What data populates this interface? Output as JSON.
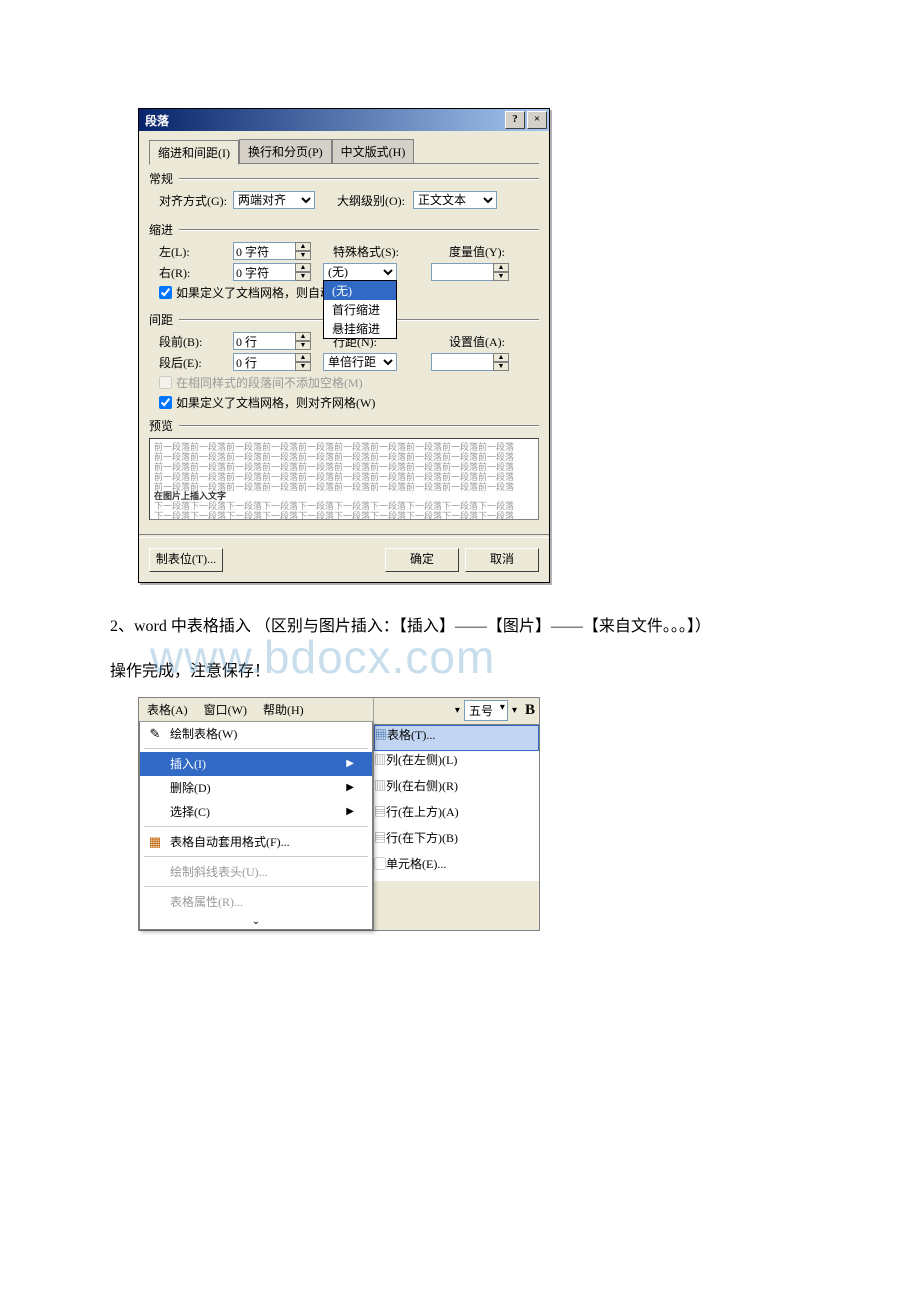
{
  "dialog": {
    "title": "段落",
    "tabs": [
      "缩进和间距(I)",
      "换行和分页(P)",
      "中文版式(H)"
    ],
    "groups": {
      "general": "常规",
      "alignment_label": "对齐方式(G):",
      "alignment_value": "两端对齐",
      "outline_label": "大纲级别(O):",
      "outline_value": "正文文本",
      "indent": "缩进",
      "left_label": "左(L):",
      "left_value": "0 字符",
      "right_label": "右(R):",
      "right_value": "0 字符",
      "special_label": "特殊格式(S):",
      "special_value": "(无)",
      "measure_label": "度量值(Y):",
      "special_options": [
        "(无)",
        "首行缩进",
        "悬挂缩进"
      ],
      "chk_grid_indent": "如果定义了文档网格，则自动调",
      "spacing": "间距",
      "before_label": "段前(B):",
      "before_value": "0 行",
      "after_label": "段后(E):",
      "after_value": "0 行",
      "linespacing_label": "行距(N):",
      "linespacing_value": "单倍行距",
      "setvalue_label": "设置值(A):",
      "chk_nospace": "在相同样式的段落间不添加空格(M)",
      "chk_grid_align": "如果定义了文档网格，则对齐网格(W)",
      "preview": "预览",
      "preview_lines": [
        "前一段落前一段落前一段落前一段落前一段落前一段落前一段落前一段落前一段落前一段落",
        "前一段落前一段落前一段落前一段落前一段落前一段落前一段落前一段落前一段落前一段落",
        "前一段落前一段落前一段落前一段落前一段落前一段落前一段落前一段落前一段落前一段落",
        "前一段落前一段落前一段落前一段落前一段落前一段落前一段落前一段落前一段落前一段落",
        "前一段落前一段落前一段落前一段落前一段落前一段落前一段落前一段落前一段落前一段落",
        "在图片上插入文字",
        "下一段落下一段落下一段落下一段落下一段落下一段落下一段落下一段落下一段落下一段落",
        "下一段落下一段落下一段落下一段落下一段落下一段落下一段落下一段落下一段落下一段落"
      ]
    },
    "buttons": {
      "tabstops": "制表位(T)...",
      "ok": "确定",
      "cancel": "取消"
    }
  },
  "body": {
    "para1": "2、word 中表格插入 （区别与图片插入：【插入】——【图片】——【来自文件。。。】）",
    "para2": "操作完成，注意保存！"
  },
  "watermark": "www.bdocx.com",
  "menu": {
    "menubar": [
      "表格(A)",
      "窗口(W)",
      "帮助(H)"
    ],
    "fontsize": "五号",
    "bold": "B",
    "items": {
      "draw": "绘制表格(W)",
      "insert": "插入(I)",
      "delete": "删除(D)",
      "select": "选择(C)",
      "autoformat": "表格自动套用格式(F)...",
      "diagonal": "绘制斜线表头(U)...",
      "properties": "表格属性(R)..."
    },
    "submenu": {
      "table": "表格(T)...",
      "col_left": "列(在左侧)(L)",
      "col_right": "列(在右侧)(R)",
      "row_above": "行(在上方)(A)",
      "row_below": "行(在下方)(B)",
      "cell": "单元格(E)..."
    }
  }
}
